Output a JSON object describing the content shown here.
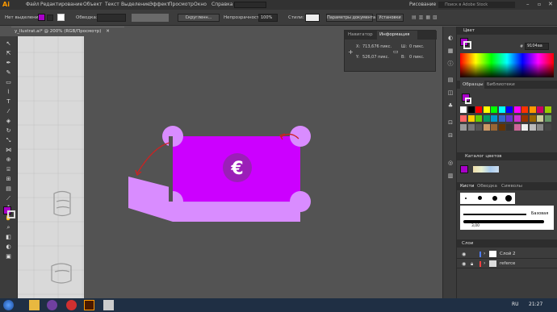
{
  "app": {
    "logo": "Ai",
    "brand_color": "#ff9a00"
  },
  "menu": [
    "Файл",
    "Редактирование",
    "Объект",
    "Текст",
    "Выделение",
    "Эффект",
    "Просмотр",
    "Окно",
    "Справка"
  ],
  "workspace": {
    "label": "Рисование",
    "stock_search_placeholder": "Поиск в Adobe Stock"
  },
  "control_bar": {
    "selection_label": "Нет выделения",
    "fill_color": "#a800c8",
    "stroke_label": "Обводка:",
    "rounded_label": "Скругленн...",
    "opacity_label": "Непрозрачность:",
    "opacity_value": "100%",
    "styles_label": "Стили:",
    "doc_settings_button": "Параметры документа",
    "preferences_button": "Установки"
  },
  "document_tab": {
    "title": "y_llustrat.ai* @ 200% (RGB/Просмотр)"
  },
  "info_panel": {
    "tabs": [
      "Навигатор",
      "Информация"
    ],
    "x_label": "X:",
    "x_value": "713,676 пикс.",
    "y_label": "Y:",
    "y_value": "526,07 пикс.",
    "w_label": "Ш:",
    "w_value": "0 пикс.",
    "h_label": "В:",
    "h_value": "0 пикс."
  },
  "color_panel": {
    "title": "Цвет",
    "hex_prefix": "#",
    "hex_value": "9104aa"
  },
  "swatches_panel": {
    "tabs": [
      "Образцы",
      "Библиотеки"
    ]
  },
  "color_guide": {
    "title": "Каталог цветов"
  },
  "brushes_panel": {
    "tabs": [
      "Кисти",
      "Обводка",
      "Символы"
    ],
    "basic_label": "Базовая",
    "size_label": "3,00"
  },
  "layers_panel": {
    "title": "Слои",
    "layers": [
      {
        "name": "Слой 2",
        "color": "#4f7fff"
      },
      {
        "name": "referce",
        "color": "#ff4040"
      }
    ]
  },
  "taskbar": {
    "lang": "RU",
    "time": "21:27"
  },
  "artwork": {
    "money_color": "#cc00ff",
    "light_color": "#d98cff",
    "coin_color": "#9b1fb8",
    "coin_symbol": "€",
    "arrow_color": "#cc2222"
  }
}
